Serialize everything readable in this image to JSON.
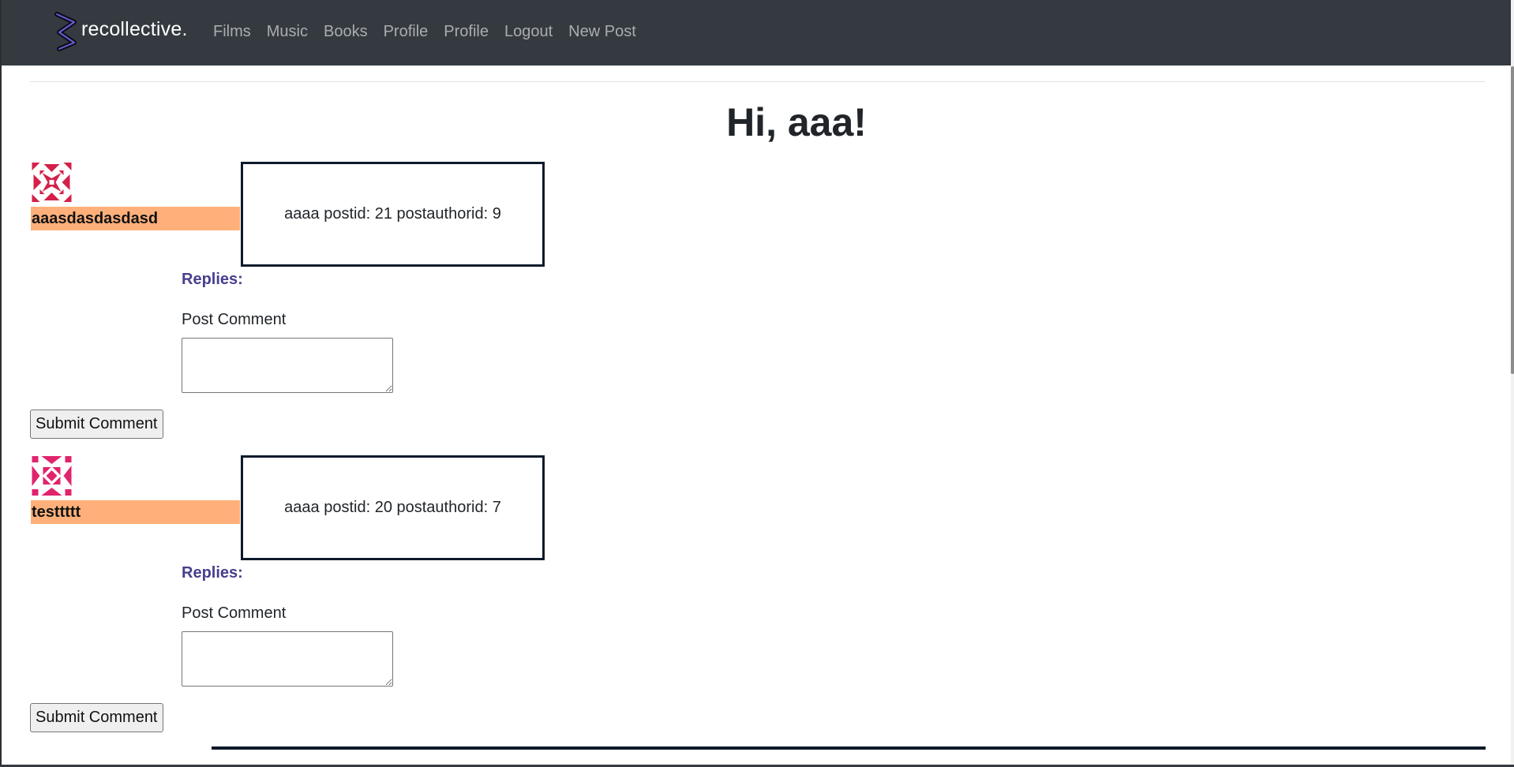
{
  "navbar": {
    "brand": "recollective.",
    "links": [
      "Films",
      "Music",
      "Books",
      "Profile",
      "Profile",
      "Logout",
      "New Post"
    ]
  },
  "greeting": "Hi, aaa!",
  "posts": [
    {
      "author": "aaasdasdasdasd",
      "content": "aaaa postid: 21 postauthorid: 9",
      "replies_label": "Replies:",
      "comment_label": "Post Comment",
      "comment_value": "",
      "submit_label": "Submit Comment"
    },
    {
      "author": "testtttt",
      "content": "aaaa postid: 20 postauthorid: 7",
      "replies_label": "Replies:",
      "comment_label": "Post Comment",
      "comment_value": "",
      "submit_label": "Submit Comment"
    }
  ],
  "colors": {
    "navbar_bg": "#343a40",
    "author_bar": "#ffb07a",
    "replies_label": "#473f8d",
    "post_border": "#0e1a2b",
    "avatar_1": "#d4204a",
    "avatar_2": "#e0246e"
  },
  "icons": {
    "brand": "recollective-logo-icon",
    "avatar_1": "identicon-avatar-icon",
    "avatar_2": "identicon-avatar-icon"
  }
}
